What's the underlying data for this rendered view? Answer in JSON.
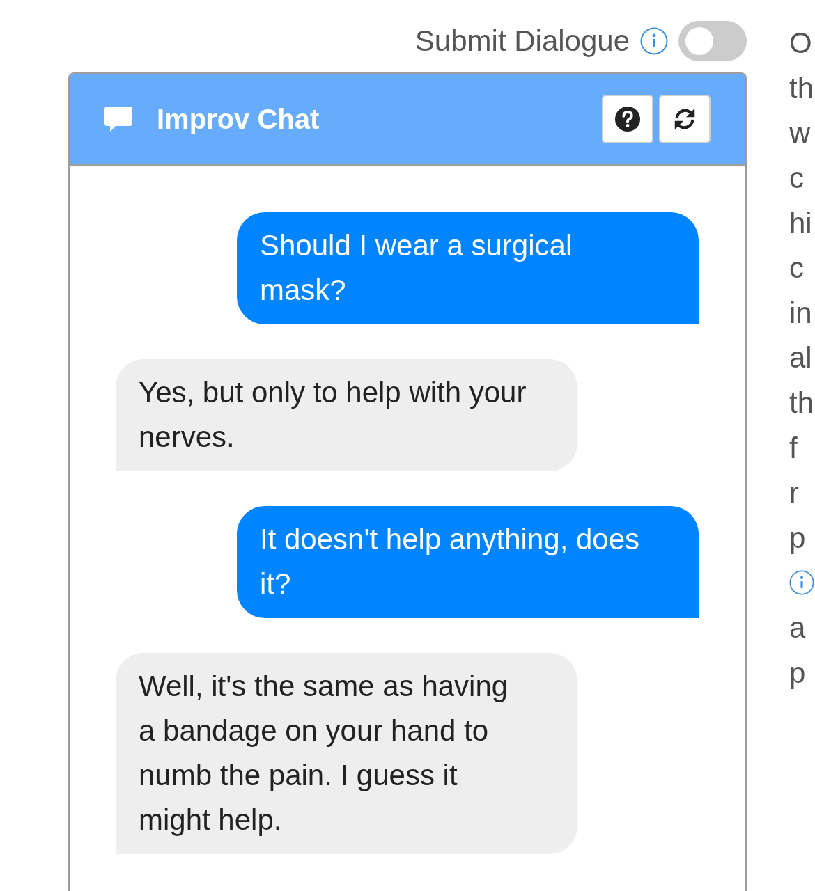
{
  "submit_dialogue": {
    "label": "Submit Dialogue",
    "on": false
  },
  "chat": {
    "title": "Improv Chat",
    "messages": [
      {
        "kind": "sent",
        "text": "Should I wear a surgical mask?"
      },
      {
        "kind": "received",
        "text": "Yes, but only to help with your nerves."
      },
      {
        "kind": "sent",
        "text": "It doesn't help anything, does it?"
      },
      {
        "kind": "received",
        "text": "Well, it's the same as having a bandage on your hand to numb the pain. I guess it might help."
      }
    ]
  },
  "side_text": {
    "lines": [
      {
        "kind": "text",
        "text": "O"
      },
      {
        "kind": "text",
        "text": "th"
      },
      {
        "kind": "text",
        "text": "w"
      },
      {
        "kind": "text",
        "text": "c"
      },
      {
        "kind": "text",
        "text": "hi"
      },
      {
        "kind": "text",
        "text": "c"
      },
      {
        "kind": "text",
        "text": "in"
      },
      {
        "kind": "text",
        "text": "al"
      },
      {
        "kind": "text",
        "text": "th"
      },
      {
        "kind": "text",
        "text": "f"
      },
      {
        "kind": "text",
        "text": "r"
      },
      {
        "kind": "text",
        "text": "p"
      },
      {
        "kind": "info_icon"
      },
      {
        "kind": "text",
        "text": "a"
      },
      {
        "kind": "text",
        "text": "p"
      }
    ]
  }
}
